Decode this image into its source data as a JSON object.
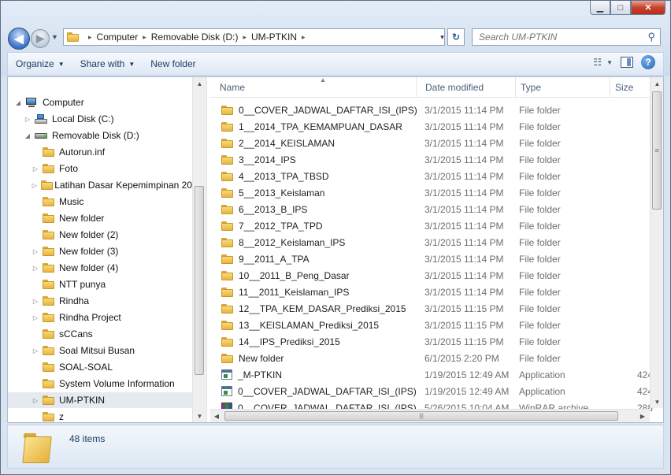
{
  "window": {
    "controls": {
      "minimize": "▁",
      "maximize": "□",
      "close": "✕"
    }
  },
  "nav": {
    "back_icon": "◀",
    "forward_icon": "▶",
    "history_drop": "▼"
  },
  "address": {
    "crumbs": [
      "Computer",
      "Removable Disk (D:)",
      "UM-PTKIN"
    ],
    "separator": "▸",
    "dropdown": "▾",
    "refresh_icon": "↻"
  },
  "search": {
    "placeholder": "Search UM-PTKIN",
    "icon": "⚲"
  },
  "toolbar": {
    "organize": "Organize",
    "share_with": "Share with",
    "new_folder": "New folder",
    "dropdown_arrow": "▼",
    "help": "?",
    "views_icon": "☷"
  },
  "nav_pane": {
    "items": [
      {
        "label": "Computer",
        "icon": "pc-icon",
        "depth": 0,
        "expander": "◢"
      },
      {
        "label": "Local Disk (C:)",
        "icon": "drive-icon",
        "depth": 1,
        "expander": "▷"
      },
      {
        "label": "Removable Disk (D:)",
        "icon": "usb-drive-icon",
        "depth": 1,
        "expander": "◢"
      },
      {
        "label": "Autorun.inf",
        "icon": "folder-icon",
        "depth": 2,
        "expander": ""
      },
      {
        "label": "Foto",
        "icon": "folder-icon",
        "depth": 2,
        "expander": "▷"
      },
      {
        "label": "Latihan Dasar Kepemimpinan 20",
        "icon": "folder-icon",
        "depth": 2,
        "expander": "▷"
      },
      {
        "label": "Music",
        "icon": "folder-icon",
        "depth": 2,
        "expander": ""
      },
      {
        "label": "New folder",
        "icon": "folder-icon",
        "depth": 2,
        "expander": ""
      },
      {
        "label": "New folder (2)",
        "icon": "folder-icon",
        "depth": 2,
        "expander": ""
      },
      {
        "label": "New folder (3)",
        "icon": "folder-icon",
        "depth": 2,
        "expander": "▷"
      },
      {
        "label": "New folder (4)",
        "icon": "folder-icon",
        "depth": 2,
        "expander": "▷"
      },
      {
        "label": "NTT punya",
        "icon": "folder-icon",
        "depth": 2,
        "expander": ""
      },
      {
        "label": "Rindha",
        "icon": "folder-icon",
        "depth": 2,
        "expander": "▷"
      },
      {
        "label": "Rindha Project",
        "icon": "folder-icon",
        "depth": 2,
        "expander": "▷"
      },
      {
        "label": "sCCans",
        "icon": "folder-icon",
        "depth": 2,
        "expander": ""
      },
      {
        "label": "Soal Mitsui Busan",
        "icon": "folder-icon",
        "depth": 2,
        "expander": "▷"
      },
      {
        "label": "SOAL-SOAL",
        "icon": "folder-icon",
        "depth": 2,
        "expander": ""
      },
      {
        "label": "System Volume Information",
        "icon": "folder-icon",
        "depth": 2,
        "expander": ""
      },
      {
        "label": "UM-PTKIN",
        "icon": "folder-icon",
        "depth": 2,
        "expander": "▷",
        "selected": true
      },
      {
        "label": "z",
        "icon": "folder-icon",
        "depth": 2,
        "expander": ""
      }
    ]
  },
  "columns": {
    "name": "Name",
    "date": "Date modified",
    "type": "Type",
    "size": "Size",
    "sort_indicator": "▲"
  },
  "files": [
    {
      "name": "0__COVER_JADWAL_DAFTAR_ISI_(IPS)",
      "date": "3/1/2015 11:14 PM",
      "type": "File folder",
      "size": "",
      "icon": "folder-icon"
    },
    {
      "name": "1__2014_TPA_KEMAMPUAN_DASAR",
      "date": "3/1/2015 11:14 PM",
      "type": "File folder",
      "size": "",
      "icon": "folder-icon"
    },
    {
      "name": "2__2014_KEISLAMAN",
      "date": "3/1/2015 11:14 PM",
      "type": "File folder",
      "size": "",
      "icon": "folder-icon"
    },
    {
      "name": "3__2014_IPS",
      "date": "3/1/2015 11:14 PM",
      "type": "File folder",
      "size": "",
      "icon": "folder-icon"
    },
    {
      "name": "4__2013_TPA_TBSD",
      "date": "3/1/2015 11:14 PM",
      "type": "File folder",
      "size": "",
      "icon": "folder-icon"
    },
    {
      "name": "5__2013_Keislaman",
      "date": "3/1/2015 11:14 PM",
      "type": "File folder",
      "size": "",
      "icon": "folder-icon"
    },
    {
      "name": "6__2013_B_IPS",
      "date": "3/1/2015 11:14 PM",
      "type": "File folder",
      "size": "",
      "icon": "folder-icon"
    },
    {
      "name": "7__2012_TPA_TPD",
      "date": "3/1/2015 11:14 PM",
      "type": "File folder",
      "size": "",
      "icon": "folder-icon"
    },
    {
      "name": "8__2012_Keislaman_IPS",
      "date": "3/1/2015 11:14 PM",
      "type": "File folder",
      "size": "",
      "icon": "folder-icon"
    },
    {
      "name": "9__2011_A_TPA",
      "date": "3/1/2015 11:14 PM",
      "type": "File folder",
      "size": "",
      "icon": "folder-icon"
    },
    {
      "name": "10__2011_B_Peng_Dasar",
      "date": "3/1/2015 11:14 PM",
      "type": "File folder",
      "size": "",
      "icon": "folder-icon"
    },
    {
      "name": "11__2011_Keislaman_IPS",
      "date": "3/1/2015 11:14 PM",
      "type": "File folder",
      "size": "",
      "icon": "folder-icon"
    },
    {
      "name": "12__TPA_KEM_DASAR_Prediksi_2015",
      "date": "3/1/2015 11:15 PM",
      "type": "File folder",
      "size": "",
      "icon": "folder-icon"
    },
    {
      "name": "13__KEISLAMAN_Prediksi_2015",
      "date": "3/1/2015 11:15 PM",
      "type": "File folder",
      "size": "",
      "icon": "folder-icon"
    },
    {
      "name": "14__IPS_Prediksi_2015",
      "date": "3/1/2015 11:15 PM",
      "type": "File folder",
      "size": "",
      "icon": "folder-icon"
    },
    {
      "name": "New folder",
      "date": "6/1/2015 2:20 PM",
      "type": "File folder",
      "size": "",
      "icon": "folder-icon"
    },
    {
      "name": "_M-PTKIN",
      "date": "1/19/2015 12:49 AM",
      "type": "Application",
      "size": "424",
      "icon": "application-icon"
    },
    {
      "name": "0__COVER_JADWAL_DAFTAR_ISI_(IPS)",
      "date": "1/19/2015 12:49 AM",
      "type": "Application",
      "size": "424",
      "icon": "application-icon"
    },
    {
      "name": "0__COVER_JADWAL_DAFTAR_ISI_(IPS)",
      "date": "5/26/2015 10:04 AM",
      "type": "WinRAR archive",
      "size": "288",
      "icon": "winrar-archive-icon"
    }
  ],
  "details": {
    "count": "48 items"
  },
  "scroll": {
    "up": "▲",
    "down": "▼",
    "left": "◀",
    "right": "▶",
    "grip": "≡",
    "hgrip": "|||"
  },
  "colors": {
    "selection": "#e5eaf1",
    "frame": "#d9e4f1",
    "close": "#c7432c"
  }
}
